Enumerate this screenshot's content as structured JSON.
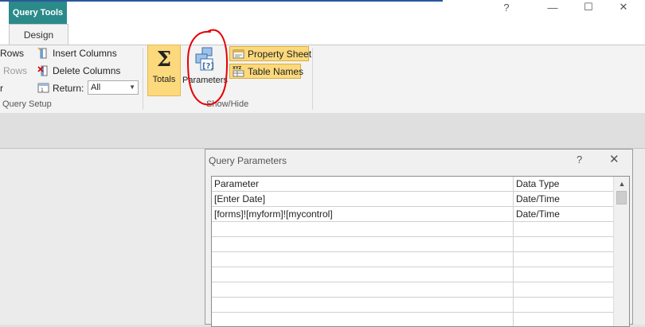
{
  "window": {
    "context_header": "Query Tools",
    "active_tab": "Design",
    "controls": [
      "?",
      "—",
      "☐",
      "✕"
    ]
  },
  "ribbon": {
    "query_setup": {
      "rows_label": "Rows",
      "rows_disabled_label": "Rows",
      "builder_fragment": "r",
      "insert_columns": "Insert Columns",
      "delete_columns": "Delete Columns",
      "return_label": "Return:",
      "return_value": "All",
      "group_label": "Query Setup"
    },
    "show_hide": {
      "totals": "Totals",
      "parameters": "Parameters",
      "property_sheet": "Property Sheet",
      "table_names": "Table Names",
      "group_label": "Show/Hide"
    }
  },
  "dialog": {
    "title": "Query Parameters",
    "help": "?",
    "close": "✕",
    "columns": [
      "Parameter",
      "Data Type"
    ],
    "rows": [
      {
        "parameter": "[Enter Date]",
        "type": "Date/Time"
      },
      {
        "parameter": "[forms]![myform]![mycontrol]",
        "type": "Date/Time"
      },
      {
        "parameter": "",
        "type": ""
      },
      {
        "parameter": "",
        "type": ""
      },
      {
        "parameter": "",
        "type": ""
      },
      {
        "parameter": "",
        "type": ""
      },
      {
        "parameter": "",
        "type": ""
      },
      {
        "parameter": "",
        "type": ""
      },
      {
        "parameter": "",
        "type": ""
      }
    ]
  },
  "annotation": {
    "color": "#e60000",
    "shape": "hand-drawn circle around Parameters button"
  },
  "colors": {
    "context_tab": "#2b8a8a",
    "toggled": "#fcd97c",
    "title_bar_accent": "#2b579a"
  }
}
